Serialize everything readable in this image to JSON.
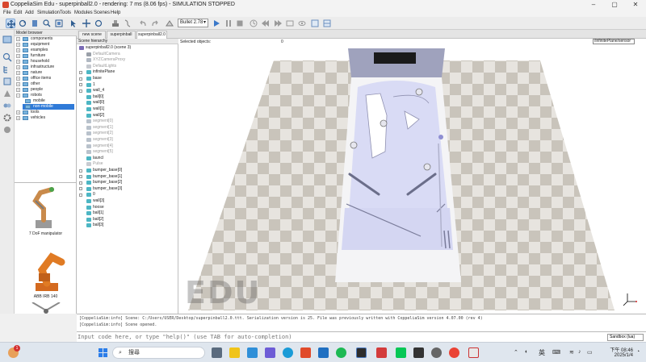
{
  "window": {
    "title": "CoppeliaSim Edu - superpinball2.0 - rendering: 7 ms (8.06 fps) - SIMULATION STOPPED",
    "minimize": "–",
    "maximize": "▢",
    "close": "✕"
  },
  "menu": [
    "File",
    "Edit",
    "Add",
    "Simulation",
    "Tools",
    "Modules",
    "Scenes",
    "Help"
  ],
  "toolbar": {
    "engine": "Bullet 2.78"
  },
  "model_browser": {
    "header": "Model browser",
    "items": [
      {
        "label": "components",
        "expanded": false
      },
      {
        "label": "equipment",
        "expanded": false
      },
      {
        "label": "examples",
        "expanded": false
      },
      {
        "label": "furniture",
        "expanded": false
      },
      {
        "label": "household",
        "expanded": false
      },
      {
        "label": "infrastructure",
        "expanded": false
      },
      {
        "label": "nature",
        "expanded": false
      },
      {
        "label": "office items",
        "expanded": false
      },
      {
        "label": "other",
        "expanded": false
      },
      {
        "label": "people",
        "expanded": false
      },
      {
        "label": "robots",
        "expanded": true
      },
      {
        "label": "mobile",
        "expanded": false
      },
      {
        "label": "non-mobile",
        "expanded": false,
        "selected": true
      },
      {
        "label": "tools",
        "expanded": false
      },
      {
        "label": "vehicles",
        "expanded": false
      }
    ],
    "previews": [
      {
        "label": "7 DoF manipulator"
      },
      {
        "label": "ABB IRB 140"
      }
    ]
  },
  "scene_tabs": [
    {
      "label": "new scene",
      "active": false
    },
    {
      "label": "superpinball",
      "active": false
    },
    {
      "label": "superpinball2.0",
      "active": true
    }
  ],
  "scene_hierarchy": {
    "header": "Scene hierarchy",
    "items": [
      {
        "label": "superpinball2.0 (scene 3)",
        "icon": "scene",
        "dim": false
      },
      {
        "label": "DefaultCamera",
        "icon": "camera",
        "dim": true
      },
      {
        "label": "XYZCameraProxy",
        "icon": "dummy",
        "dim": true
      },
      {
        "label": "DefaultLights",
        "icon": "light",
        "dim": true
      },
      {
        "label": "infinitePlane",
        "icon": "shape",
        "dim": false
      },
      {
        "label": "base",
        "icon": "shape",
        "dim": false
      },
      {
        "label": "1",
        "icon": "shape",
        "dim": false
      },
      {
        "label": "wall_4",
        "icon": "shape",
        "dim": false
      },
      {
        "label": "ball[0]",
        "icon": "shape",
        "dim": false
      },
      {
        "label": "wall[0]",
        "icon": "shape",
        "dim": false
      },
      {
        "label": "wall[1]",
        "icon": "shape",
        "dim": false
      },
      {
        "label": "wall[2]",
        "icon": "shape",
        "dim": false
      },
      {
        "label": "segment[0]",
        "icon": "segment",
        "dim": true
      },
      {
        "label": "segment[1]",
        "icon": "segment",
        "dim": true
      },
      {
        "label": "segment[2]",
        "icon": "segment",
        "dim": true
      },
      {
        "label": "segment[3]",
        "icon": "segment",
        "dim": true
      },
      {
        "label": "segment[4]",
        "icon": "segment",
        "dim": true
      },
      {
        "label": "segment[5]",
        "icon": "segment",
        "dim": true
      },
      {
        "label": "launcl",
        "icon": "shape",
        "dim": false
      },
      {
        "label": "Pulse",
        "icon": "pulse",
        "dim": true
      },
      {
        "label": "bumper_base[0]",
        "icon": "shape",
        "dim": false
      },
      {
        "label": "bumper_base[1]",
        "icon": "shape",
        "dim": false
      },
      {
        "label": "bumper_base[2]",
        "icon": "shape",
        "dim": false
      },
      {
        "label": "bumper_base[3]",
        "icon": "shape",
        "dim": false
      },
      {
        "label": "0",
        "icon": "shape",
        "dim": false
      },
      {
        "label": "wall[3]",
        "icon": "shape",
        "dim": false
      },
      {
        "label": "hoose",
        "icon": "shape",
        "dim": false
      },
      {
        "label": "ball[1]",
        "icon": "shape",
        "dim": false
      },
      {
        "label": "ball[2]",
        "icon": "shape",
        "dim": false
      },
      {
        "label": "ball[3]",
        "icon": "shape",
        "dim": false
      }
    ]
  },
  "viewport": {
    "selected_objects_label": "Selected objects:",
    "selected_objects_count": "0",
    "floor_label": "/infinitePlane/sensor",
    "watermark": "EDU"
  },
  "console": {
    "lines": [
      "[CoppeliaSim:info]  Scene: C:/Users/USER/Desktop/superpinball2.0.ttt. Serialization version is 25. File was previously written with CoppeliaSim version 4.07.00 (rev 4)",
      "[CoppeliaSim:info]  Scene opened."
    ]
  },
  "command": {
    "placeholder": "Input code here, or type \"help()\" (use TAB for auto-completion)",
    "language": "Sandbox (lua)"
  },
  "taskbar": {
    "weather_badge": "1",
    "search_label": "搜尋",
    "tray_lang": "英",
    "time": "下午 08:46",
    "date": "2025/1/4"
  }
}
